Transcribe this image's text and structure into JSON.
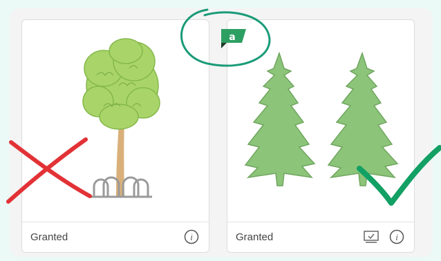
{
  "cards": [
    {
      "caption": "Granted",
      "image": "deciduous-tree-with-bike-rack",
      "marker": "red-cross",
      "icons": [
        "info-icon"
      ]
    },
    {
      "caption": "Granted",
      "image": "two-fir-trees",
      "marker": "green-checkmark",
      "icons": [
        "screen-check-icon",
        "info-icon"
      ]
    }
  ],
  "badge": {
    "icon": "letter-a-badge-icon",
    "color": "#2e9f63"
  },
  "colors": {
    "cross": "#e23236",
    "check": "#12a064",
    "circle": "#1a9b78",
    "tree_green": "#8fc96e",
    "fir_green": "#88c078"
  }
}
